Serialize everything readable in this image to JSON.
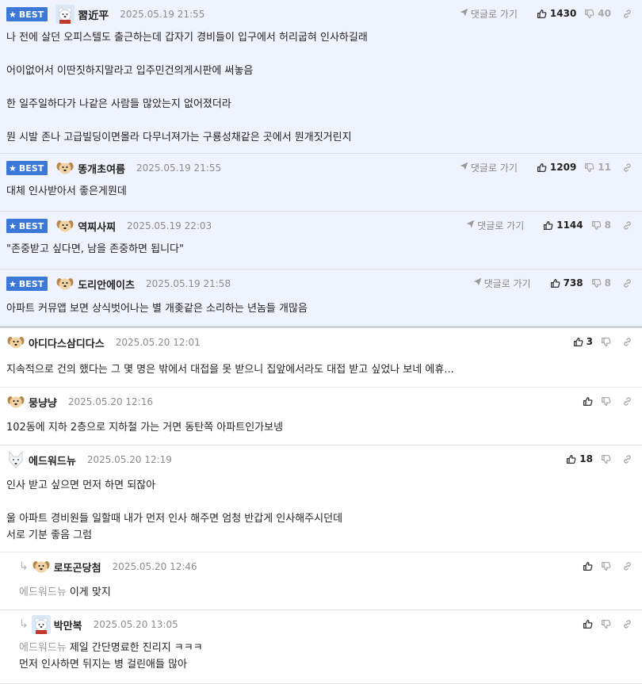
{
  "reply_link_label": "댓글로 가기",
  "best_label": "BEST",
  "comments": [
    {
      "best": true,
      "avatar": "bear",
      "nick": "習近平",
      "date": "2025.05.19 21:55",
      "up": "1430",
      "down": "40",
      "show_reply_link": true,
      "lines": [
        "나 전에 살던 오피스텔도 출근하는데 갑자기 경비들이 입구에서 허리굽혀 인사하길래",
        "",
        "어이없어서 이딴짓하지말라고 입주민건의게시판에 써놓음",
        "",
        "한 일주일하다가 나같은 사람들 많았는지 없어졌더라",
        "",
        "뭔 시발 존나 고급빌딩이면몰라 다무너져가는 구룡성채같은 곳에서 뭔개짓거린지"
      ]
    },
    {
      "best": true,
      "avatar": "dog",
      "nick": "똥개초여름",
      "date": "2025.05.19 21:55",
      "up": "1209",
      "down": "11",
      "show_reply_link": true,
      "lines": [
        "대체 인사받아서 좋은게뭔데"
      ]
    },
    {
      "best": true,
      "avatar": "dog",
      "nick": "역찌사찌",
      "date": "2025.05.19 22:03",
      "up": "1144",
      "down": "8",
      "show_reply_link": true,
      "lines": [
        "\"존중받고 싶다면, 남을 존중하면 됩니다\""
      ]
    },
    {
      "best": true,
      "avatar": "dog",
      "nick": "도리안에이츠",
      "date": "2025.05.19 21:58",
      "up": "738",
      "down": "8",
      "show_reply_link": true,
      "lines": [
        "아파트 커뮤앱 보면 상식벗어나는 별 개좆같은 소리하는 년놈들 개많음"
      ]
    },
    {
      "best": false,
      "avatar": "dog",
      "nick": "아디다스삼디다스",
      "date": "2025.05.20 12:01",
      "up": "3",
      "down": "",
      "show_reply_link": false,
      "lines": [
        "지속적으로 건의 했다는 그 몇 명은 밖에서 대접을 못 받으니 집앞에서라도 대접 받고 싶었나 보네 에휴..."
      ]
    },
    {
      "best": false,
      "avatar": "dog",
      "nick": "뭉냥냥",
      "date": "2025.05.20 12:16",
      "up": "",
      "down": "",
      "show_reply_link": false,
      "lines": [
        "102동에 지하 2층으로 지하철 가는 거면 동탄쪽 아파트인가보넹"
      ]
    },
    {
      "best": false,
      "avatar": "wolf",
      "nick": "에드워드뉴",
      "date": "2025.05.20 12:19",
      "up": "18",
      "down": "",
      "show_reply_link": false,
      "lines": [
        "인사 받고 싶으면 먼저 하면 되잖아",
        "",
        "울 아파트 경비원들 일할때 내가 먼저 인사 해주면 엄청 반갑게 인사해주시던데",
        "서로 기분 좋음 그럼"
      ]
    },
    {
      "best": false,
      "reply": true,
      "avatar": "dog",
      "nick": "로또곤당첨",
      "date": "2025.05.20 12:46",
      "up": "",
      "down": "",
      "show_reply_link": false,
      "mention": "에드워드뉴",
      "lines": [
        "이게 맞지"
      ]
    },
    {
      "best": false,
      "reply": true,
      "avatar": "bear",
      "nick": "박만복",
      "date": "2025.05.20 13:05",
      "up": "",
      "down": "",
      "show_reply_link": false,
      "mention": "에드워드뉴",
      "lines": [
        "제일 간단명료한 진리지 ㅋㅋㅋ",
        "먼저 인사하면 뒤지는 병 걸린애들 많아"
      ]
    }
  ]
}
